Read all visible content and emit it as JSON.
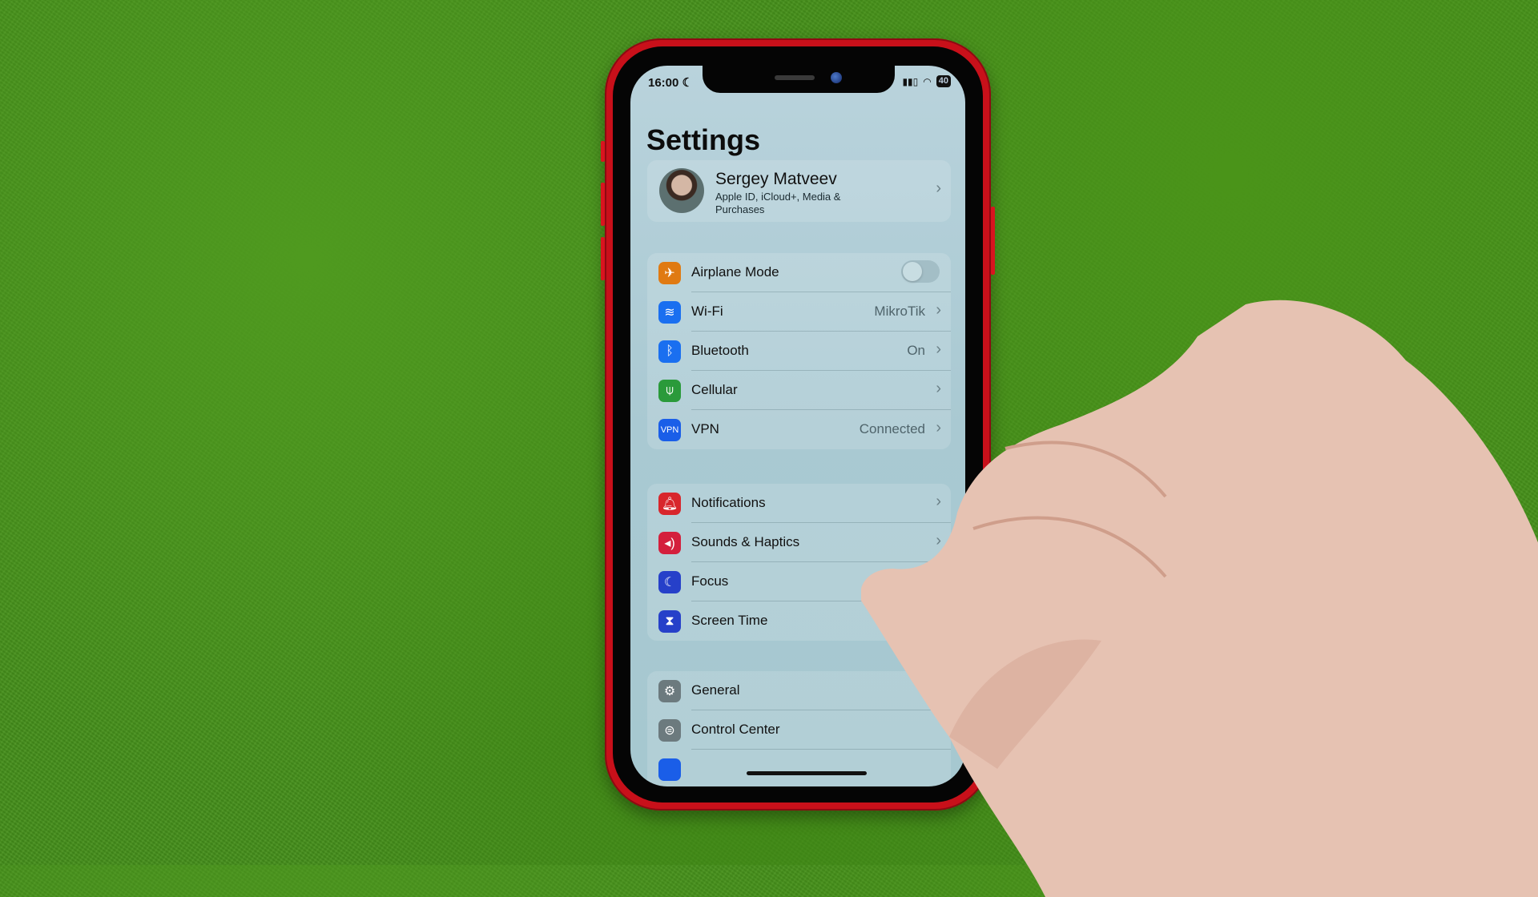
{
  "status_bar": {
    "time": "16:00",
    "focus_icon": "moon-icon",
    "battery": "40",
    "signal_icon": "cellular-signal-icon",
    "wifi_icon": "wifi-icon"
  },
  "title": "Settings",
  "profile": {
    "name": "Sergey Matveev",
    "subtitle": "Apple ID, iCloud+, Media & Purchases"
  },
  "groups": [
    {
      "items": [
        {
          "label": "Airplane Mode",
          "icon": "airplane-icon",
          "color": "#e07a12",
          "toggle": false
        },
        {
          "label": "Wi-Fi",
          "icon": "wifi-icon",
          "color": "#1a6ff0",
          "value": "MikroTik"
        },
        {
          "label": "Bluetooth",
          "icon": "bluetooth-icon",
          "color": "#1a6ff0",
          "value": "On"
        },
        {
          "label": "Cellular",
          "icon": "antenna-icon",
          "color": "#2a9a3a",
          "value": ""
        },
        {
          "label": "VPN",
          "icon": "vpn-icon",
          "color": "#1a5ee8",
          "value": "Connected",
          "icon_text": "VPN"
        }
      ]
    },
    {
      "items": [
        {
          "label": "Notifications",
          "icon": "bell-icon",
          "color": "#d8262c"
        },
        {
          "label": "Sounds & Haptics",
          "icon": "speaker-icon",
          "color": "#d41f3c"
        },
        {
          "label": "Focus",
          "icon": "moon-icon",
          "color": "#2640c9"
        },
        {
          "label": "Screen Time",
          "icon": "hourglass-icon",
          "color": "#2640c9"
        }
      ]
    },
    {
      "items": [
        {
          "label": "General",
          "icon": "gear-icon",
          "color": "#6c7a7e"
        },
        {
          "label": "Control Center",
          "icon": "switches-icon",
          "color": "#6c7a7e"
        }
      ]
    }
  ],
  "colors": {
    "phone_frame": "#c8101a",
    "grass": "#45901a",
    "screen_bg": "#b0cdd6"
  }
}
